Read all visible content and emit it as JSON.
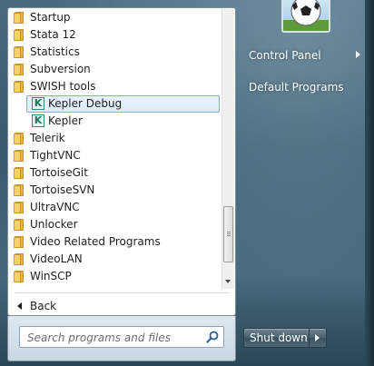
{
  "programs": [
    {
      "label": "Startup",
      "type": "folder"
    },
    {
      "label": "Stata 12",
      "type": "folder"
    },
    {
      "label": "Statistics",
      "type": "folder"
    },
    {
      "label": "Subversion",
      "type": "folder"
    },
    {
      "label": "SWISH tools",
      "type": "folder"
    },
    {
      "label": "Kepler Debug",
      "type": "app",
      "selected": true
    },
    {
      "label": "Kepler",
      "type": "app"
    },
    {
      "label": "Telerik",
      "type": "folder"
    },
    {
      "label": "TightVNC",
      "type": "folder"
    },
    {
      "label": "TortoiseGit",
      "type": "folder"
    },
    {
      "label": "TortoiseSVN",
      "type": "folder"
    },
    {
      "label": "UltraVNC",
      "type": "folder"
    },
    {
      "label": "Unlocker",
      "type": "folder"
    },
    {
      "label": "Video Related Programs",
      "type": "folder"
    },
    {
      "label": "VideoLAN",
      "type": "folder"
    },
    {
      "label": "WinSCP",
      "type": "folder"
    }
  ],
  "app_icon_letter": "K",
  "back_label": "Back",
  "search": {
    "placeholder": "Search programs and files"
  },
  "right_panel": {
    "control_panel": "Control Panel",
    "default_programs": "Default Programs"
  },
  "shutdown_label": "Shut down",
  "icons": {
    "folder": "folder-icon",
    "search": "search-icon",
    "back": "back-arrow-icon",
    "submenu": "chevron-right-icon",
    "user": "user-picture-soccer-ball"
  },
  "colors": {
    "folder_yellow": "#f3c544",
    "selection_border": "#84acdd",
    "app_icon_green": "#1b7a62"
  }
}
